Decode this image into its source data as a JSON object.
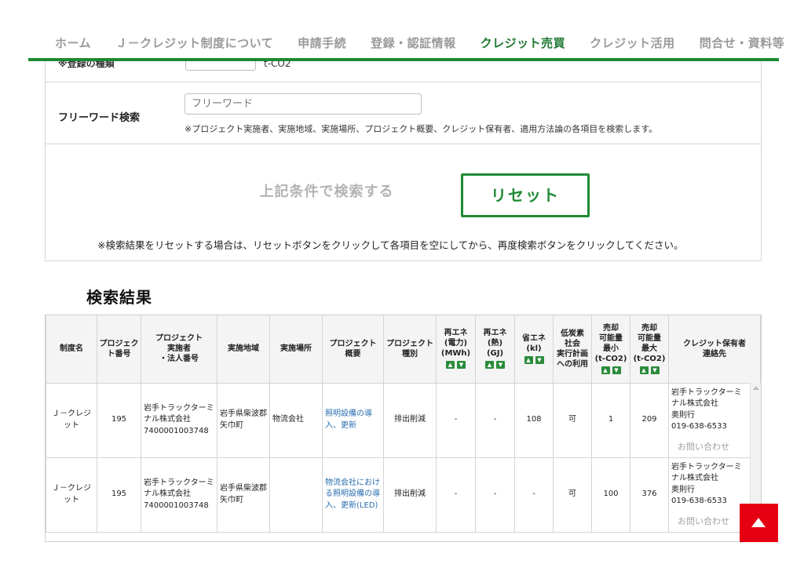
{
  "nav": {
    "items": [
      "ホーム",
      "Ｊ－クレジット制度について",
      "申請手続",
      "登録・認証情報",
      "クレジット売買",
      "クレジット活用",
      "問合せ・資料等"
    ],
    "active_index": 4
  },
  "form": {
    "partial_row": {
      "label": "※登録の種類",
      "value": "t-CO2"
    },
    "freeword": {
      "label": "フリーワード検索",
      "placeholder": "フリーワード",
      "note": "※プロジェクト実施者、実施地域、実施場所、プロジェクト概要、クレジット保有者、適用方法論の各項目を検索します。"
    },
    "search_button": "上記条件で検索する",
    "reset_button": "リセット",
    "reset_note": "※検索結果をリセットする場合は、リセットボタンをクリックして各項目を空にしてから、再度検索ボタンをクリックしてください。"
  },
  "results": {
    "title": "検索結果",
    "headers": {
      "system": "制度名",
      "project_no": "プロジェク\nト番号",
      "implementer": "プロジェクト\n実施者\n・法人番号",
      "region": "実施地域",
      "site": "実施場所",
      "summary": "プロジェクト\n概要",
      "type": "プロジェクト\n種別",
      "re_power": "再エネ\n(電力)\n(MWh)",
      "re_heat": "再エネ\n(熱)\n(GJ)",
      "energy_saving": "省エネ\n(kl)",
      "low_carbon": "低炭素\n社会\n実行計画\nへの利用",
      "sale_min": "売却\n可能量\n最小\n(t-CO2)",
      "sale_max": "売却\n可能量\n最大\n(t-CO2)",
      "contact": "クレジット保有者\n連絡先"
    },
    "sort_labels": {
      "up": "▲",
      "down": "▼"
    },
    "rows": [
      {
        "system": "Ｊ－クレジット",
        "project_no": "195",
        "implementer": "岩手トラックターミナル株式会社\n7400001003748",
        "region": "岩手県柴波郡矢巾町",
        "site": "物流会社",
        "summary": "照明設備の導入、更新",
        "type": "排出削減",
        "re_power": "-",
        "re_heat": "-",
        "energy_saving": "108",
        "low_carbon": "可",
        "sale_min": "1",
        "sale_max": "209",
        "contact_company": "岩手トラックターミナル株式会社",
        "contact_person": "奥則行",
        "contact_phone": "019-638-6533",
        "inquiry": "お問い合わせ"
      },
      {
        "system": "Ｊ－クレジット",
        "project_no": "195",
        "implementer": "岩手トラックターミナル株式会社\n7400001003748",
        "region": "岩手県柴波郡矢巾町",
        "site": "",
        "summary": "物流会社における照明設備の導入、更新(LED)",
        "type": "排出削減",
        "re_power": "-",
        "re_heat": "-",
        "energy_saving": "-",
        "low_carbon": "可",
        "sale_min": "100",
        "sale_max": "376",
        "contact_company": "岩手トラックターミナル株式会社",
        "contact_person": "奥則行",
        "contact_phone": "019-638-6533",
        "inquiry": "お問い合わせ"
      }
    ]
  },
  "back_to_top_icon": "up-arrow-icon",
  "colors": {
    "brand_green": "#1f8a34",
    "link_blue": "#2a6cb0",
    "top_button_red": "#e60012"
  }
}
